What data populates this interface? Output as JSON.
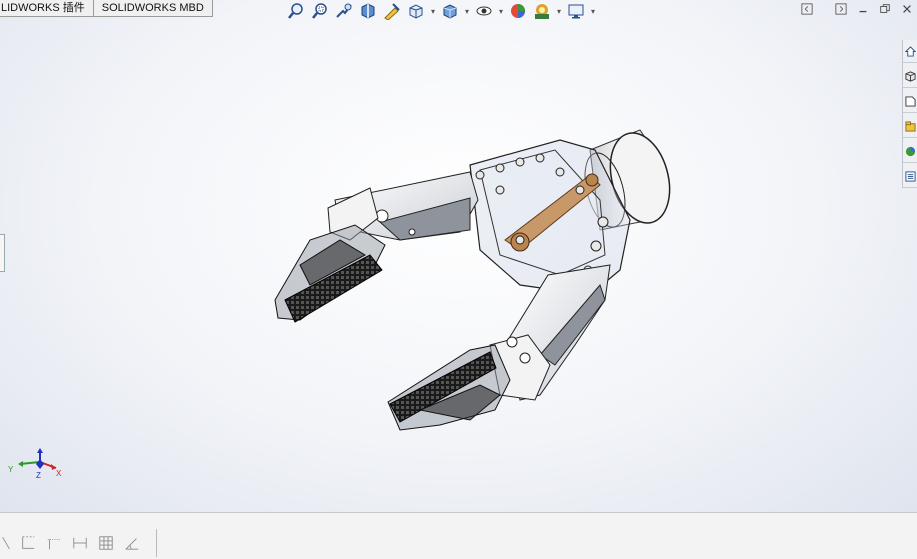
{
  "tabs": [
    {
      "label": "LIDWORKS 插件"
    },
    {
      "label": "SOLIDWORKS MBD"
    }
  ],
  "headsup_icons": [
    "zoom-to-fit-icon",
    "zoom-to-area-icon",
    "previous-view-icon",
    "section-view-icon",
    "dynamic-annotation-icon",
    "view-orientation-icon",
    "display-style-icon",
    "hide-show-items-icon",
    "edit-appearance-icon",
    "apply-scene-icon",
    "view-settings-icon"
  ],
  "window_icons": [
    "tile-left-icon",
    "tile-right-icon",
    "minimize-icon",
    "restore-icon"
  ],
  "task_pane_icons": [
    "home-icon",
    "3d-parts-icon",
    "design-library-icon",
    "file-explorer-icon",
    "appearances-icon",
    "custom-properties-icon"
  ],
  "triad": {
    "x": "X",
    "y": "Y",
    "z": "Z"
  },
  "sketch_tools": [
    "smart-dimension-icon",
    "corner-rectangle-icon",
    "centerline-icon",
    "distance-icon",
    "grid-icon",
    "angle-icon"
  ],
  "colors": {
    "accent": "#1f5fbf",
    "x_axis": "#d02020",
    "y_axis": "#2a9a2a",
    "z_axis": "#2030c0"
  }
}
